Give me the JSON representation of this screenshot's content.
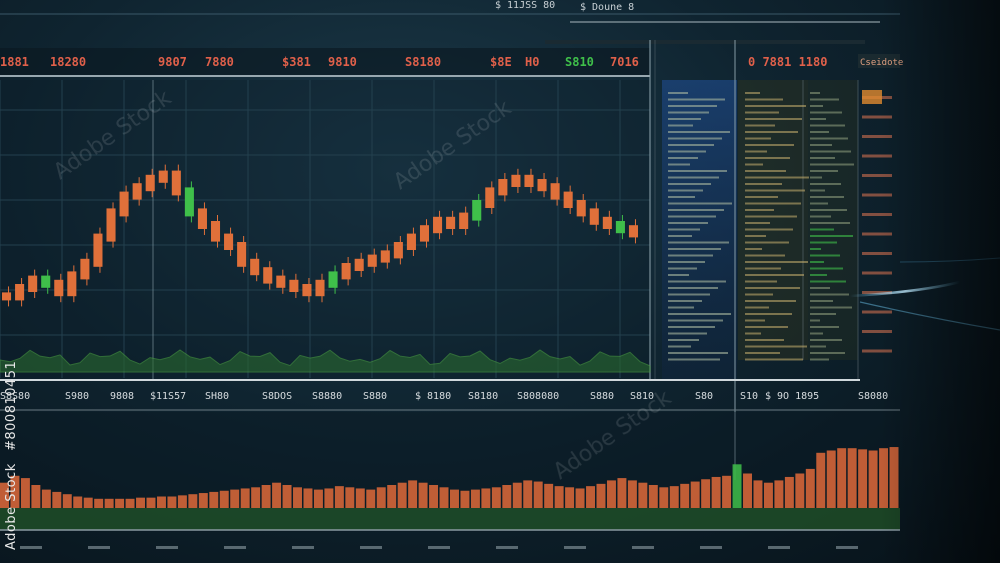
{
  "top_header": {
    "left_code": "$ 11JSS 80",
    "right_code": "$ Doune 8"
  },
  "ticker_bar": {
    "items": [
      {
        "label": "1881",
        "value": "18280",
        "color": "#e0604a"
      },
      {
        "label": "9807",
        "value": "7880",
        "color": "#e0604a"
      },
      {
        "label": "$381",
        "value": "9810",
        "color": "#e0604a"
      },
      {
        "label": "",
        "value": "S8180",
        "color": "#e0604a"
      },
      {
        "label": "$8E",
        "value": "H0",
        "color": "#e0604a"
      },
      {
        "label": "",
        "value": "S810",
        "color": "#3fbf4a"
      },
      {
        "label": "",
        "value": "7016",
        "color": "#e0604a"
      }
    ],
    "right_value": "0 7881 1180",
    "right_badge": "Cseidote"
  },
  "axis_bar": {
    "labels": [
      "S8S80",
      "S980",
      "9808",
      "$11S57",
      "SH80",
      "S8DOS",
      "S8880",
      "S880",
      "$ 8180",
      "S8180",
      "S808080",
      "S880",
      "S810",
      "S80",
      "S10",
      "$ 9O 1895",
      "S8080"
    ]
  },
  "side_label": {
    "text1": "Adobe Stock",
    "text2": "#800810451"
  },
  "watermark": "Adobe Stock",
  "colors": {
    "candle_up": "#3fbf4a",
    "candle_down": "#e0703a",
    "background": "#0f2430"
  },
  "chart_data": {
    "type": "bar",
    "title": "",
    "price_series": [
      38,
      40,
      42,
      41,
      39,
      43,
      46,
      52,
      58,
      62,
      64,
      66,
      67,
      63,
      58,
      55,
      52,
      50,
      46,
      44,
      42,
      41,
      40,
      39,
      41,
      43,
      45,
      46,
      47,
      48,
      50,
      52,
      54,
      56,
      55,
      57,
      60,
      63,
      65,
      66,
      65,
      64,
      62,
      60,
      58,
      56,
      55,
      54,
      53
    ],
    "volume_series": [
      22,
      28,
      26,
      20,
      16,
      14,
      12,
      10,
      9,
      8,
      8,
      8,
      8,
      9,
      9,
      10,
      10,
      11,
      12,
      13,
      14,
      15,
      16,
      17,
      18,
      20,
      22,
      20,
      18,
      17,
      16,
      17,
      19,
      18,
      17,
      16,
      18,
      20,
      22,
      24,
      22,
      20,
      18,
      16,
      15,
      16,
      17,
      18,
      20,
      22,
      24,
      23,
      21,
      19,
      18,
      17,
      19,
      21,
      24,
      26,
      24,
      22,
      20,
      18,
      19,
      21,
      23,
      25,
      27,
      28,
      38,
      30,
      24,
      22,
      24,
      27,
      30,
      34,
      48,
      50,
      52,
      52,
      51,
      50,
      52,
      53
    ]
  }
}
